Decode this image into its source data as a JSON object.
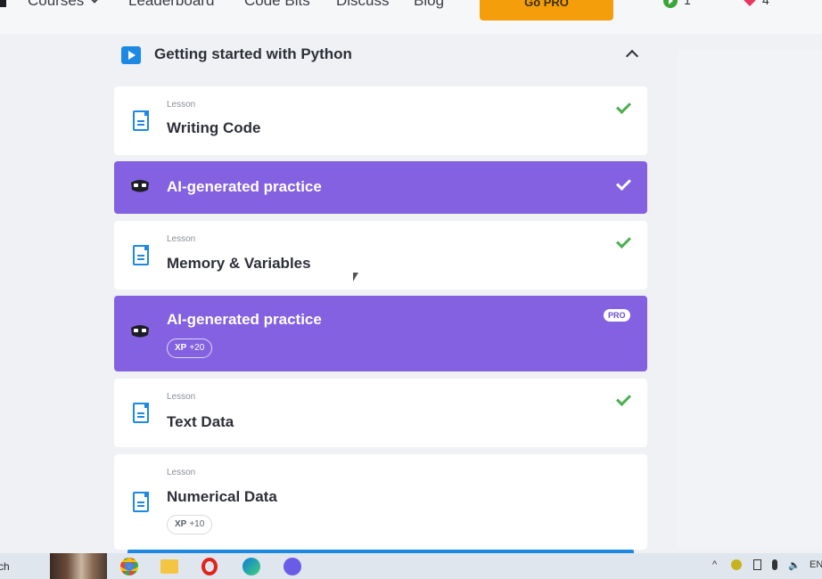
{
  "nav": {
    "items": [
      "Courses",
      "Leaderboard",
      "Code Bits",
      "Discuss",
      "Blog"
    ],
    "go_pro": "Go PRO",
    "streak_count": "1",
    "hearts_count": "4"
  },
  "section": {
    "title": "Getting started with Python"
  },
  "cards": {
    "c1": {
      "kicker": "Lesson",
      "title": "Writing Code"
    },
    "c2": {
      "title": "AI-generated practice"
    },
    "c3": {
      "kicker": "Lesson",
      "title": "Memory & Variables"
    },
    "c4": {
      "title": "AI-generated practice",
      "xp_label": "XP",
      "xp_value": "+20",
      "badge": "PRO"
    },
    "c5": {
      "kicker": "Lesson",
      "title": "Text Data"
    },
    "c6": {
      "kicker": "Lesson",
      "title": "Numerical Data",
      "xp_label": "XP",
      "xp_value": "+10"
    }
  },
  "taskbar": {
    "search_fragment": "ch",
    "language": "EN"
  },
  "colors": {
    "accent_purple": "#8361e0",
    "check_green": "#4caf50",
    "brand_blue": "#1e88e5",
    "go_pro_orange": "#f59e0b"
  }
}
